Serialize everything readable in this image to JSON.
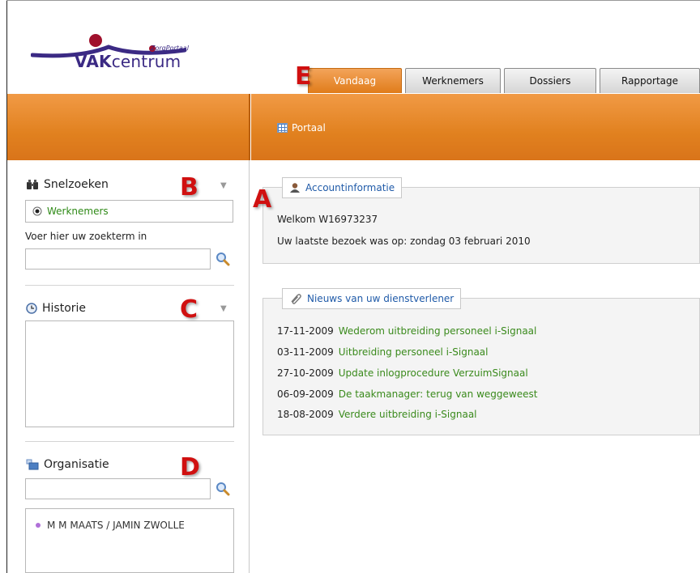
{
  "logo": {
    "brand_bold": "VAK",
    "brand_rest": "centrum",
    "sub": "ZorgPortaal"
  },
  "tabs": [
    {
      "label": "Vandaag",
      "active": true
    },
    {
      "label": "Werknemers",
      "active": false
    },
    {
      "label": "Dossiers",
      "active": false
    },
    {
      "label": "Rapportage",
      "active": false
    }
  ],
  "toolbar": {
    "portaal_label": "Portaal"
  },
  "sidebar": {
    "snelzoeken": {
      "title": "Snelzoeken",
      "radio_label": "Werknemers",
      "search_label": "Voer hier uw zoekterm in",
      "search_value": ""
    },
    "historie": {
      "title": "Historie"
    },
    "organisatie": {
      "title": "Organisatie",
      "search_value": "",
      "items": [
        "M M MAATS / JAMIN ZWOLLE"
      ]
    }
  },
  "account": {
    "legend": "Accountinformatie",
    "welcome": "Welkom W16973237",
    "last_visit": "Uw laatste bezoek was op: zondag 03 februari 2010"
  },
  "news": {
    "legend": "Nieuws van uw dienstverlener",
    "items": [
      {
        "date": "17-11-2009",
        "title": "Wederom uitbreiding personeel i-Signaal"
      },
      {
        "date": "03-11-2009",
        "title": "Uitbreiding personeel i-Signaal"
      },
      {
        "date": "27-10-2009",
        "title": "Update inlogprocedure VerzuimSignaal"
      },
      {
        "date": "06-09-2009",
        "title": "De taakmanager: terug van weggeweest"
      },
      {
        "date": "18-08-2009",
        "title": "Verdere uitbreiding i-Signaal"
      }
    ]
  },
  "annotations": {
    "a": "A",
    "b": "B",
    "c": "C",
    "d": "D",
    "e": "E"
  },
  "colors": {
    "accent_orange": "#e07c1a",
    "link_green": "#3a8a1c",
    "link_blue": "#1f5aa8",
    "annotation_red": "#d01010"
  }
}
